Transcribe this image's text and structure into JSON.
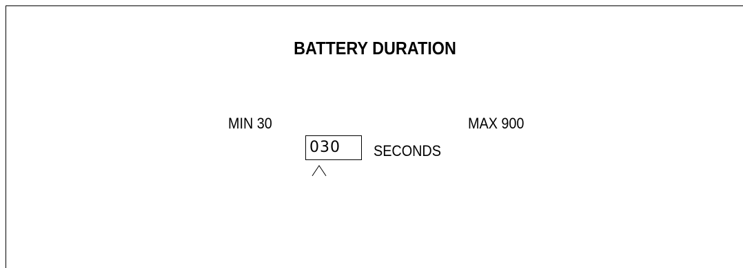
{
  "screen": {
    "title": "BATTERY DURATION",
    "min_label": "MIN  30",
    "max_label": "MAX  900",
    "value_field": {
      "value": "030",
      "unit": "SECONDS"
    }
  },
  "icons": {
    "cursor": "caret-up-icon"
  }
}
